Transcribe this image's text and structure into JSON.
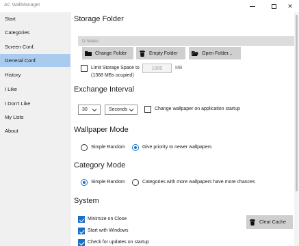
{
  "window": {
    "title": "AC WallManager"
  },
  "sidebar": {
    "items": [
      {
        "label": "Start"
      },
      {
        "label": "Categories"
      },
      {
        "label": "Screen Conf."
      },
      {
        "label": "General Conf."
      },
      {
        "label": "History"
      },
      {
        "label": "I Like"
      },
      {
        "label": "I Don't Like"
      },
      {
        "label": "My Lists"
      },
      {
        "label": "About"
      }
    ],
    "active_index": 3
  },
  "storage": {
    "heading": "Storage Folder",
    "path": "D:\\Walls",
    "change_folder_label": "Change Folder",
    "empty_folder_label": "Empty Folder",
    "open_folder_label": "Open Folder...",
    "limit_label": "Limit Storage Space to",
    "limit_checked": false,
    "limit_value": "1000",
    "limit_unit": "MB",
    "occupied_note": "(1368 MBs ocupied)"
  },
  "exchange": {
    "heading": "Exchange Interval",
    "interval_value": "30",
    "interval_unit": "Seconds",
    "change_on_startup_label": "Change wallpaper on application startup",
    "change_on_startup_checked": false
  },
  "wallpaper_mode": {
    "heading": "Wallpaper Mode",
    "options": [
      "Simple Random",
      "Give priority to newer wallpapers"
    ],
    "selected": "Give priority to newer wallpapers"
  },
  "category_mode": {
    "heading": "Category Mode",
    "options": [
      "Simple Random",
      "Categories with more wallpapers have more chances"
    ],
    "selected": "Simple Random"
  },
  "system": {
    "heading": "System",
    "minimize_on_close_label": "Minimize on Close",
    "minimize_on_close_checked": true,
    "start_with_windows_label": "Start with Windows",
    "start_with_windows_checked": true,
    "check_updates_label": "Check for updates on startup",
    "check_updates_checked": true,
    "clear_cache_label": "Clear Cache"
  },
  "colors": {
    "accent": "#1870c9",
    "sidebar_active": "#a8cbee",
    "button_bg": "#cfcfcf"
  },
  "icons": {
    "change_folder": "folder-icon",
    "empty_folder": "trash-icon",
    "open_folder": "open-folder-icon",
    "clear_cache": "trash-icon"
  }
}
